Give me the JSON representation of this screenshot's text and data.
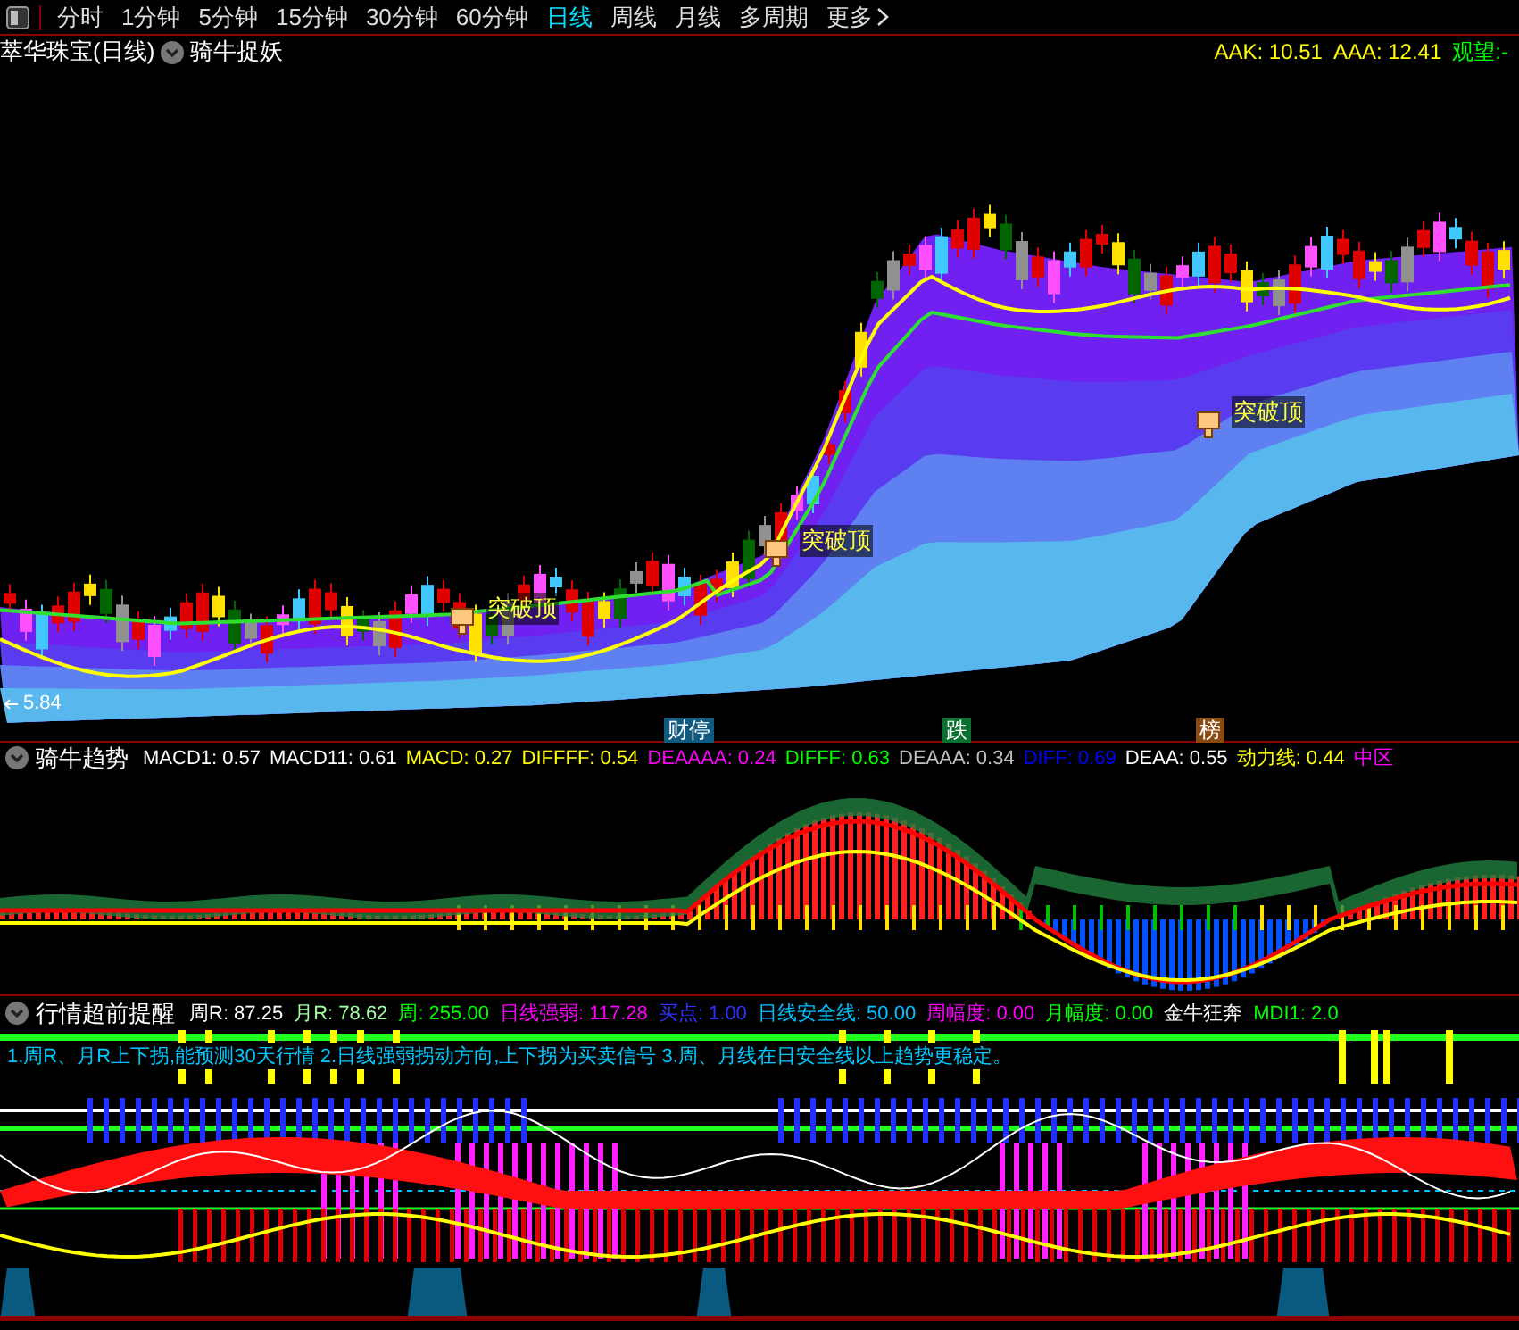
{
  "toolbar": {
    "periods": [
      {
        "label": "分时",
        "selected": false
      },
      {
        "label": "1分钟",
        "selected": false
      },
      {
        "label": "5分钟",
        "selected": false
      },
      {
        "label": "15分钟",
        "selected": false
      },
      {
        "label": "30分钟",
        "selected": false
      },
      {
        "label": "60分钟",
        "selected": false
      },
      {
        "label": "日线",
        "selected": true
      },
      {
        "label": "周线",
        "selected": false
      },
      {
        "label": "月线",
        "selected": false
      },
      {
        "label": "多周期",
        "selected": false
      },
      {
        "label": "更多",
        "selected": false
      }
    ]
  },
  "main_panel": {
    "title": "萃华珠宝(日线)",
    "indicator": "骑牛捉妖",
    "readouts": [
      {
        "text": "AAK: 10.51",
        "color": "#ffff00"
      },
      {
        "text": "AAA: 12.41",
        "color": "#ffff00"
      },
      {
        "text": "观望:-",
        "color": "#00ff00"
      }
    ],
    "price_label": "5.84",
    "annotations": [
      {
        "text": "突破顶"
      },
      {
        "text": "突破顶"
      },
      {
        "text": "突破顶"
      }
    ],
    "markers": [
      {
        "text": "财停",
        "color": "#0e5a80"
      },
      {
        "text": "跌",
        "color": "#0a7030"
      },
      {
        "text": "榜",
        "color": "#8a4a10"
      }
    ]
  },
  "trend_panel": {
    "title": "骑牛趋势",
    "readouts": [
      {
        "text": "MACD1: 0.57",
        "color": "#ffffff"
      },
      {
        "text": "MACD11: 0.61",
        "color": "#ffffff"
      },
      {
        "text": "MACD: 0.27",
        "color": "#ffff00"
      },
      {
        "text": "DIFFFF: 0.54",
        "color": "#ffff00"
      },
      {
        "text": "DEAAAA: 0.24",
        "color": "#ff00ff"
      },
      {
        "text": "DIFFF: 0.63",
        "color": "#00ff00"
      },
      {
        "text": "DEAAA: 0.34",
        "color": "#c0c0c0"
      },
      {
        "text": "DIFF: 0.69",
        "color": "#0000ff"
      },
      {
        "text": "DEAA: 0.55",
        "color": "#ffffff"
      },
      {
        "text": "动力线: 0.44",
        "color": "#ffff00"
      },
      {
        "text": "中区",
        "color": "#ff00ff"
      }
    ]
  },
  "alert_panel": {
    "title": "行情超前提醒",
    "readouts": [
      {
        "text": "周R: 87.25",
        "color": "#ffffff"
      },
      {
        "text": "月R: 78.62",
        "color": "#a0ffa0"
      },
      {
        "text": "周: 255.00",
        "color": "#00ff00"
      },
      {
        "text": "日线强弱: 117.28",
        "color": "#ff00ff"
      },
      {
        "text": "买点: 1.00",
        "color": "#3030ff"
      },
      {
        "text": "日线安全线: 50.00",
        "color": "#00c0ff"
      },
      {
        "text": "周幅度: 0.00",
        "color": "#ff00ff"
      },
      {
        "text": "月幅度: 0.00",
        "color": "#00ff00"
      },
      {
        "text": "金牛狂奔",
        "color": "#ffffff"
      },
      {
        "text": "MDI1: 2.0",
        "color": "#00ff00"
      }
    ],
    "note": "1.周R、月R上下拐,能预测30天行情 2.日线强弱拐动方向,上下拐为买卖信号 3.周、月线在日安全线以上趋势更稳定。"
  }
}
